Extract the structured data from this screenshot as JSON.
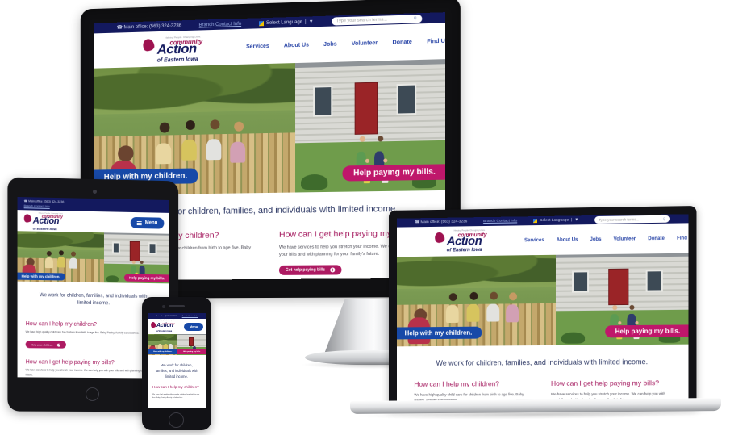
{
  "site": {
    "topbar": {
      "phone_label": "Main office: (563) 324-3236",
      "phone_icon": "phone-icon",
      "branch_link": "Branch Contact Info",
      "language_label": "Select Language",
      "language_caret": "▼",
      "language_divider": "|",
      "search_placeholder": "Type your search terms...",
      "search_icon": "search-icon"
    },
    "logo": {
      "tagline": "Helping People. Changing Lives.",
      "line1": "community",
      "line2": "Action",
      "line3": "of Eastern Iowa",
      "mark": "heart-icon"
    },
    "nav": [
      {
        "label": "Services"
      },
      {
        "label": "About Us"
      },
      {
        "label": "Jobs"
      },
      {
        "label": "Volunteer"
      },
      {
        "label": "Donate"
      },
      {
        "label": "Find Us"
      }
    ],
    "hero": {
      "left_ribbon": "Help with my children.",
      "right_ribbon": "Help paying my bills.",
      "left_photo_alt": "children-at-fence-photo",
      "right_photo_alt": "family-in-front-of-house-photo"
    },
    "tagline_row": "We work for children, families, and individuals with limited income.",
    "columns": [
      {
        "heading": "How can I help my children?",
        "body": "We have high quality child care for children from birth to age five. Baby Pantry, Activity scholarships.",
        "cta": "Help your children",
        "cta_icon": "arrow-right-icon"
      },
      {
        "heading": "How can I get help paying my bills?",
        "body": "We have services to help you stretch your income. We can help you with your bills and with planning for your family's future.",
        "cta": "Get help paying bills",
        "cta_icon": "arrow-right-icon"
      }
    ],
    "mobile": {
      "menu_label": "Menu",
      "menu_icon": "hamburger-icon"
    }
  },
  "colors": {
    "navy": "#13195e",
    "brand_blue": "#1749a8",
    "brand_pink": "#bf176b",
    "magenta": "#a4195e",
    "link_blue": "#2b47a8"
  },
  "devices": [
    {
      "name": "desktop-monitor"
    },
    {
      "name": "tablet"
    },
    {
      "name": "smartphone"
    },
    {
      "name": "laptop"
    }
  ]
}
